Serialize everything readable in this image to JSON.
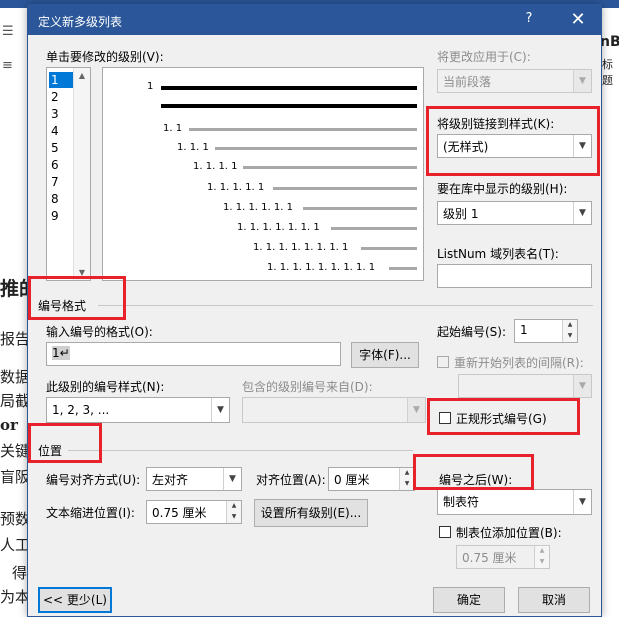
{
  "background": {
    "lines": [
      "推的",
      "报告",
      "数据",
      "局截",
      "or",
      "关键",
      "盲阪",
      "预数",
      "人工",
      "得",
      "为本"
    ],
    "right_text": [
      "nBI",
      "标题"
    ]
  },
  "dialog": {
    "title": "定义新多级列表",
    "help": "?",
    "close": "✕"
  },
  "levels": {
    "label": "单击要修改的级别(V):",
    "items": [
      "1",
      "2",
      "3",
      "4",
      "5",
      "6",
      "7",
      "8",
      "9"
    ],
    "selected": "1"
  },
  "preview": {
    "numbers": [
      "1",
      "1. 1",
      "1. 1. 1",
      "1. 1. 1. 1",
      "1. 1. 1. 1. 1",
      "1. 1. 1. 1. 1. 1",
      "1. 1. 1. 1. 1. 1. 1",
      "1. 1. 1. 1. 1. 1. 1. 1",
      "1. 1. 1. 1. 1. 1. 1. 1. 1"
    ]
  },
  "apply_to": {
    "label": "将更改应用于(C):",
    "value": "当前段落"
  },
  "link_style": {
    "label": "将级别链接到样式(K):",
    "value": "(无样式)"
  },
  "gallery_level": {
    "label": "要在库中显示的级别(H):",
    "value": "级别 1"
  },
  "listnum": {
    "label": "ListNum 域列表名(T):",
    "value": ""
  },
  "number_format_section": "编号格式",
  "format_input": {
    "label": "输入编号的格式(O):",
    "value": "1↵"
  },
  "font_button": "字体(F)...",
  "start_at": {
    "label": "起始编号(S):",
    "value": "1"
  },
  "restart": {
    "label": "重新开始列表的间隔(R):",
    "value": ""
  },
  "number_style": {
    "label": "此级别的编号样式(N):",
    "value": "1, 2, 3, ..."
  },
  "include_level": {
    "label": "包含的级别编号来自(D):",
    "value": ""
  },
  "legal_style": {
    "label": "正规形式编号(G)"
  },
  "position_section": "位置",
  "alignment": {
    "label": "编号对齐方式(U):",
    "value": "左对齐"
  },
  "aligned_at": {
    "label": "对齐位置(A):",
    "value": "0 厘米"
  },
  "follow_number": {
    "label": "编号之后(W):",
    "value": "制表符"
  },
  "indent_at": {
    "label": "文本缩进位置(I):",
    "value": "0.75 厘米"
  },
  "set_all_button": "设置所有级别(E)...",
  "tab_stop": {
    "label": "制表位添加位置(B):",
    "value": "0.75 厘米"
  },
  "less_button": "<< 更少(L)",
  "ok_button": "确定",
  "cancel_button": "取消",
  "highlight_color": "#e8222a",
  "titlebar_color": "#2b579a"
}
